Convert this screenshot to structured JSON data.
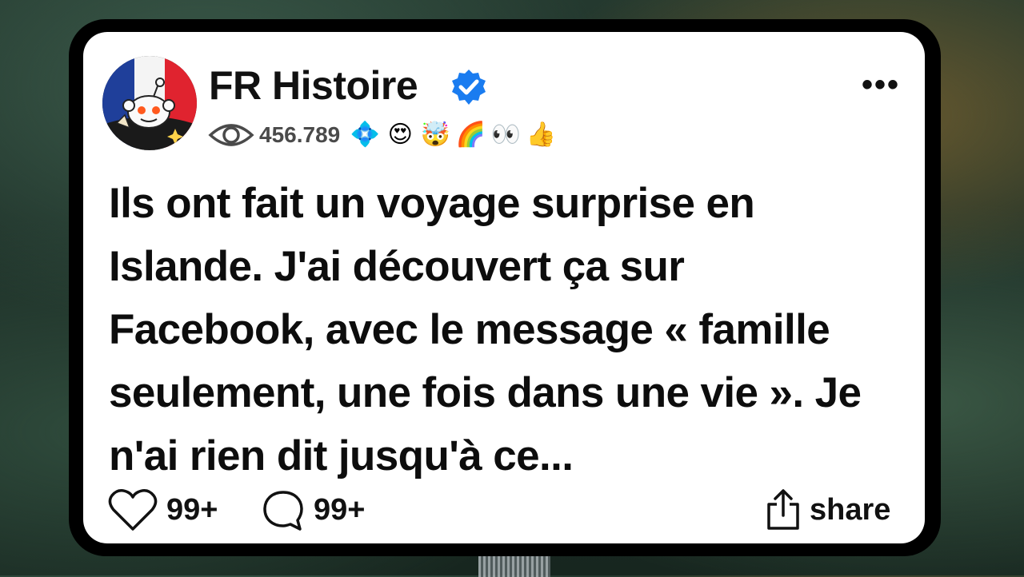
{
  "post": {
    "author": "FR Histoire",
    "views": "456.789",
    "awards": [
      "💠",
      "😍",
      "🤯",
      "🌈",
      "👀",
      "👍"
    ],
    "text": "Ils ont fait un voyage surprise en Islande. J'ai découvert ça sur Facebook, avec le message « famille seulement, une fois dans une vie ». Je n'ai rien dit jusqu'à ce...",
    "likes": "99+",
    "comments": "99+",
    "share_label": "share"
  },
  "colors": {
    "verified": "#1a7cf0",
    "card": "#ffffff",
    "frame": "#000000"
  }
}
